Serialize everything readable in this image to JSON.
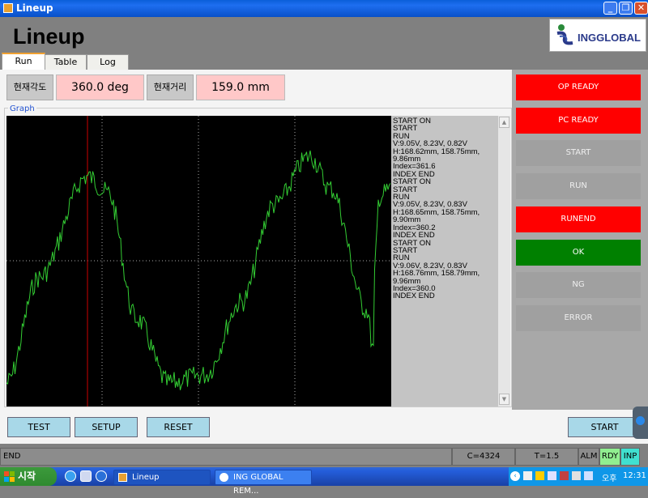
{
  "window": {
    "title": "Lineup"
  },
  "app": {
    "title": "Lineup",
    "logo_text": "INGGLOBAL"
  },
  "tabs": [
    {
      "label": "Run"
    },
    {
      "label": "Table"
    },
    {
      "label": "Log"
    }
  ],
  "readouts": {
    "angle_label": "현재각도",
    "angle_value": "360.0  deg",
    "distance_label": "현재거리",
    "distance_value": "159.0  mm"
  },
  "graph": {
    "legend": "Graph"
  },
  "log_lines": [
    "START ON",
    "START",
    "RUN",
    "V:9.05V, 8.23V, 0.82V",
    "H:168.62mm, 158.75mm,",
    "9.86mm",
    "Index=361.6",
    "INDEX END",
    "START ON",
    "START",
    "RUN",
    "V:9.05V, 8.23V, 0.83V",
    "H:168.65mm, 158.75mm,",
    "9.90mm",
    "Index=360.2",
    "INDEX END",
    "START ON",
    "START",
    "RUN",
    "V:9.06V, 8.23V, 0.83V",
    "H:168.76mm, 158.79mm,",
    "9.96mm",
    "Index=360.0",
    "INDEX END"
  ],
  "indicators": [
    {
      "label": "OP READY",
      "state": "red"
    },
    {
      "label": "PC READY",
      "state": "red"
    },
    {
      "label": "START",
      "state": "gray"
    },
    {
      "label": "RUN",
      "state": "gray"
    },
    {
      "label": "RUNEND",
      "state": "red"
    },
    {
      "label": "OK",
      "state": "green"
    },
    {
      "label": "NG",
      "state": "gray"
    },
    {
      "label": "ERROR",
      "state": "gray"
    }
  ],
  "buttons": {
    "test": "TEST",
    "setup": "SETUP",
    "reset": "RESET",
    "start": "START"
  },
  "status": {
    "message": "END",
    "count": "C=4324",
    "time": "T=1.5",
    "alm": "ALM",
    "rdy": "RDY",
    "inp": "INP"
  },
  "taskbar": {
    "start_label": "시작",
    "items": [
      "Lineup",
      "ING GLOBAL REM..."
    ],
    "clock_ampm": "오후",
    "clock_time": "12:31"
  },
  "colors": {
    "indicator_red": "#ff0000",
    "indicator_green": "#008000",
    "indicator_gray": "#a0a0a0",
    "trace": "#33cc33",
    "marker": "#cc0000"
  }
}
